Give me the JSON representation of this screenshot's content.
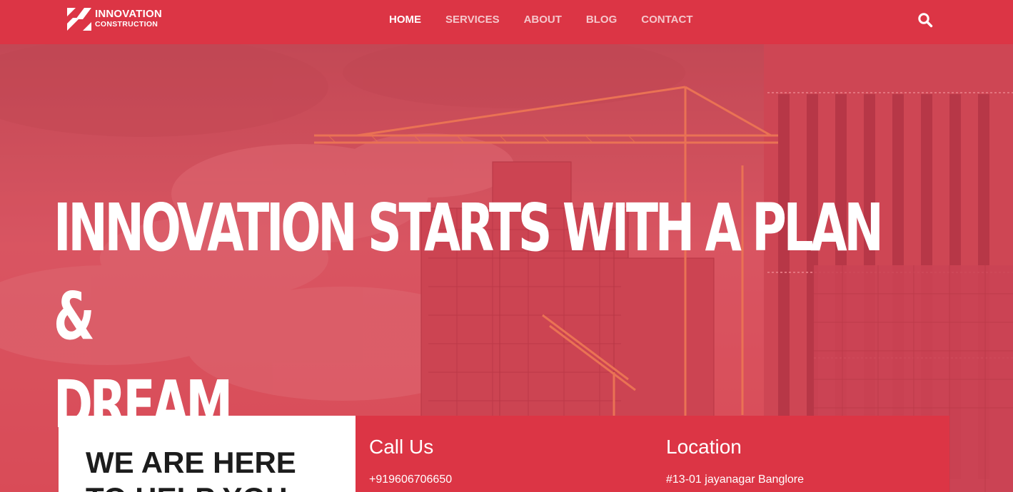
{
  "brand": {
    "line1": "INNOVATION",
    "line2": "CONSTRUCTION",
    "icon": "logo-mark-icon"
  },
  "nav": {
    "items": [
      {
        "label": "HOME",
        "active": true
      },
      {
        "label": "SERVICES",
        "active": false
      },
      {
        "label": "ABOUT",
        "active": false
      },
      {
        "label": "BLOG",
        "active": false
      },
      {
        "label": "CONTACT",
        "active": false
      }
    ],
    "search_icon": "search-icon"
  },
  "hero": {
    "title_line1": "INNOVATION STARTS WITH A PLAN &",
    "title_line2": "DREAM"
  },
  "help": {
    "title_line1": "WE ARE HERE",
    "title_line2": "TO HELP YOU"
  },
  "contact": {
    "call": {
      "heading": "Call Us",
      "value": "+919606706650"
    },
    "location": {
      "heading": "Location",
      "value": "#13-01 jayanagar Banglore"
    }
  },
  "colors": {
    "brand_red": "#dc3545",
    "overlay": "#d9545f",
    "text_dark": "#1c1c1c"
  }
}
